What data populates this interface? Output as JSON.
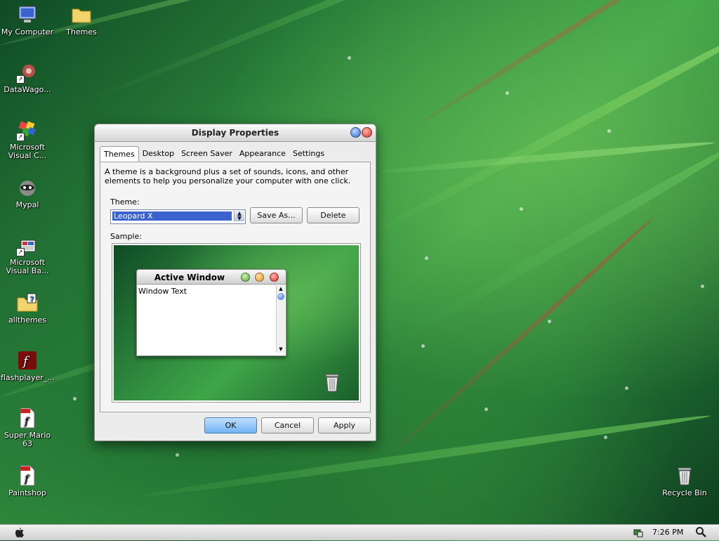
{
  "desktop": {
    "icons": [
      {
        "label": "My Computer",
        "icon": "computer-icon"
      },
      {
        "label": "Themes",
        "icon": "folder-icon"
      },
      {
        "label": "DataWago...",
        "icon": "datawagon-icon"
      },
      {
        "label": "Microsoft Visual C...",
        "icon": "visual-c-icon"
      },
      {
        "label": "Mypal",
        "icon": "mypal-icon"
      },
      {
        "label": "Microsoft Visual Ba...",
        "icon": "visual-basic-icon"
      },
      {
        "label": "allthemes",
        "icon": "folder-icon"
      },
      {
        "label": "flashplayer_...",
        "icon": "flash-icon"
      },
      {
        "label": "Super Mario 63",
        "icon": "swf-icon"
      },
      {
        "label": "Paintshop",
        "icon": "swf-icon"
      },
      {
        "label": "Recycle Bin",
        "icon": "trash-icon"
      }
    ]
  },
  "dialog": {
    "title": "Display Properties",
    "tabs": [
      "Themes",
      "Desktop",
      "Screen Saver",
      "Appearance",
      "Settings"
    ],
    "active_tab": "Themes",
    "description": "A theme is a background plus a set of sounds, icons, and other elements to help you personalize your computer with one click.",
    "theme_label": "Theme:",
    "theme_value": "Leopard X",
    "save_as_label": "Save As...",
    "delete_label": "Delete",
    "sample_label": "Sample:",
    "sample": {
      "window_title": "Active Window",
      "window_text": "Window Text"
    },
    "ok_label": "OK",
    "cancel_label": "Cancel",
    "apply_label": "Apply"
  },
  "taskbar": {
    "time": "7:26 PM"
  },
  "colors": {
    "accent": "#3a63cf",
    "close": "#e0362e",
    "minimize": "#3a78d8"
  }
}
